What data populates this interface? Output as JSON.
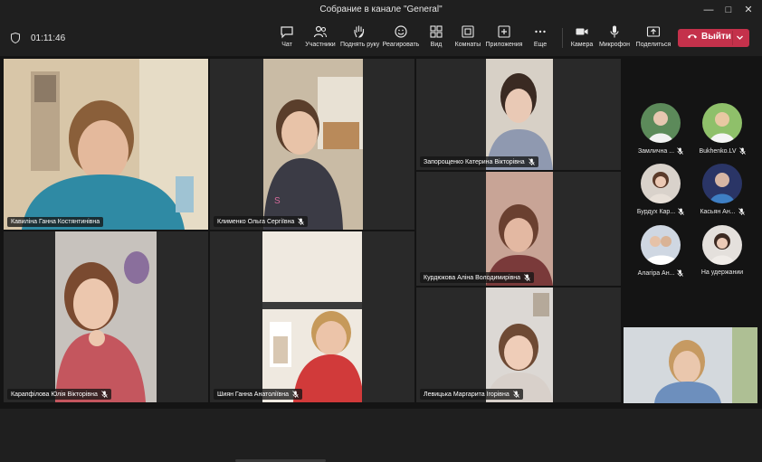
{
  "window": {
    "title": "Собрание в канале \"General\""
  },
  "meeting": {
    "timer": "01:11:46"
  },
  "toolbar": {
    "chat": "Чат",
    "participants": "Участники",
    "raise_hand": "Поднять руку",
    "react": "Реагировать",
    "view": "Вид",
    "rooms": "Комнаты",
    "apps": "Приложения",
    "more": "Еще",
    "camera": "Камера",
    "mic": "Микрофон",
    "share": "Поделиться",
    "leave": "Выйти"
  },
  "tiles": [
    {
      "name": "Кавиліна Ганна Костянтинівна",
      "mic": "on"
    },
    {
      "name": "Клименко Ольга Сергіївна",
      "mic": "muted"
    },
    {
      "name": "Запорощенко Катерина Вікторівна",
      "mic": "muted"
    },
    {
      "name": "Курдюкова Аліна Володимирівна",
      "mic": "muted"
    },
    {
      "name": "Карапфілова Юлія Вікторівна",
      "mic": "muted"
    },
    {
      "name": "Шиян Ганна Анатоліївна",
      "mic": "muted"
    },
    {
      "name": "Левицька Маргарита Ігорівна",
      "mic": "muted"
    }
  ],
  "side_participants": [
    {
      "name": "Замлична ...",
      "mic": "muted"
    },
    {
      "name": "Bukhenko.LV",
      "mic": "muted"
    },
    {
      "name": "Бурдух Кар...",
      "mic": "muted"
    },
    {
      "name": "Касьян Ан...",
      "mic": "muted"
    },
    {
      "name": "Алагіра Ан...",
      "mic": "muted"
    },
    {
      "name": "На удержании",
      "mic": "none"
    }
  ],
  "colors": {
    "accent": "#7f85f5",
    "leave": "#c4314b",
    "background": "#1f1f1f"
  }
}
